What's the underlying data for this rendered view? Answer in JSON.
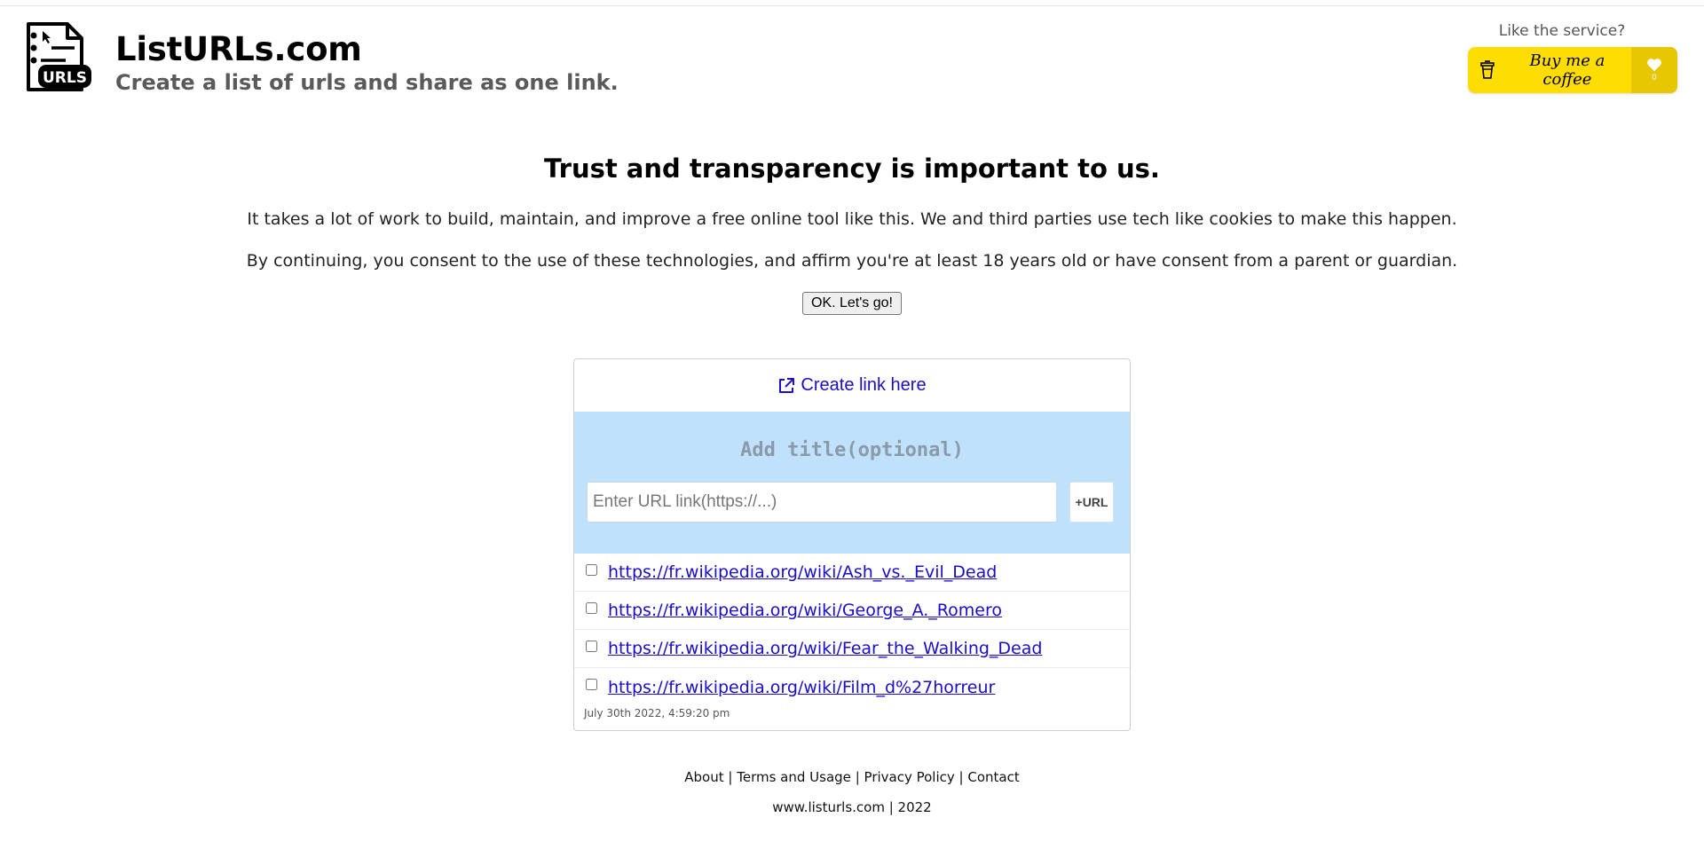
{
  "header": {
    "title": "ListURLs.com",
    "subtitle": "Create a list of urls and share as one link.",
    "logo_icon": "urls-document-logo-icon",
    "logo_text": "URLS"
  },
  "coffee": {
    "label": "Like the service?",
    "button_label": "Buy me a coffee",
    "count": "0",
    "color": "#FFDD00"
  },
  "consent": {
    "heading": "Trust and transparency is important to us.",
    "paragraph1": "It takes a lot of work to build, maintain, and improve a free online tool like this. We and third parties use tech like cookies to make this happen.",
    "paragraph2": "By continuing, you consent to the use of these technologies, and affirm you're at least 18 years old or have consent from a parent or guardian.",
    "button_label": "OK. Let's go!"
  },
  "card": {
    "create_link_label": "Create link here",
    "title_placeholder": "Add title(optional)",
    "url_placeholder": "Enter URL link(https://...)",
    "add_url_label": "+URL",
    "panel_color": "#BFE1FC",
    "urls": [
      "https://fr.wikipedia.org/wiki/Ash_vs._Evil_Dead",
      "https://fr.wikipedia.org/wiki/George_A._Romero",
      "https://fr.wikipedia.org/wiki/Fear_the_Walking_Dead",
      "https://fr.wikipedia.org/wiki/Film_d%27horreur"
    ],
    "timestamp": "July 30th 2022, 4:59:20 pm"
  },
  "footer": {
    "links": [
      "About",
      "Terms and Usage",
      "Privacy Policy",
      "Contact"
    ],
    "separator": "|",
    "copyright": "www.listurls.com | 2022"
  }
}
